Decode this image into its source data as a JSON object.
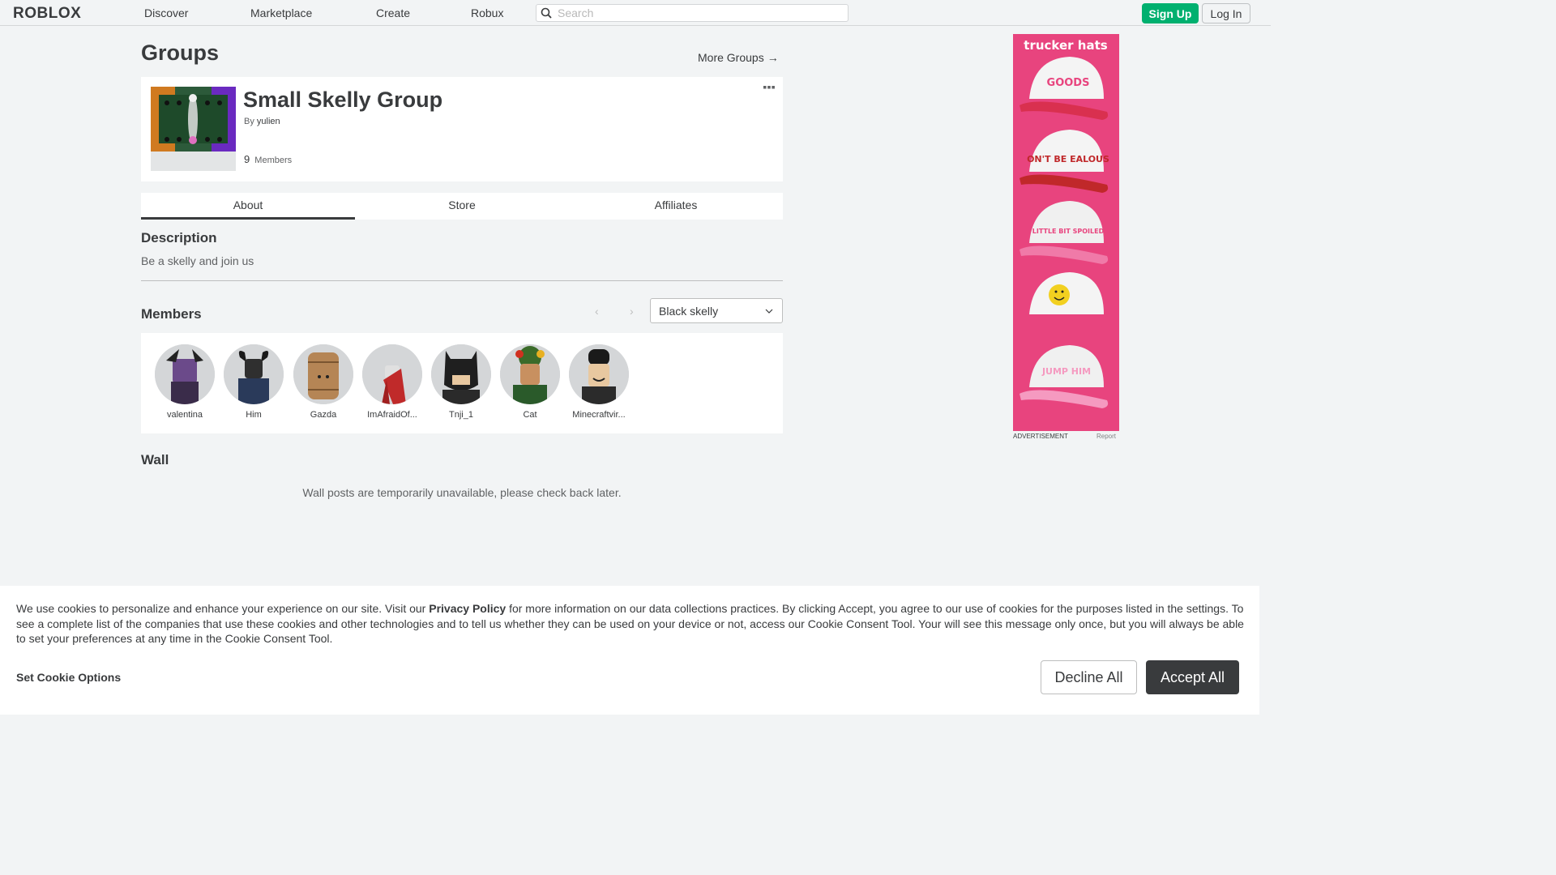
{
  "nav": {
    "logo": "ROBLOX",
    "links": [
      "Discover",
      "Marketplace",
      "Create",
      "Robux"
    ],
    "search_placeholder": "Search",
    "signup": "Sign Up",
    "login": "Log In"
  },
  "header": {
    "title": "Groups",
    "more_groups": "More Groups",
    "more_groups_arrow": "→"
  },
  "group": {
    "name": "Small Skelly Group",
    "owner_prefix": "By",
    "owner": "yulien",
    "member_count": "9",
    "members_label": "Members"
  },
  "tabs": [
    "About",
    "Store",
    "Affiliates"
  ],
  "description": {
    "title": "Description",
    "text": "Be a skelly and join us"
  },
  "members": {
    "title": "Members",
    "role_selected": "Black skelly",
    "prev": "‹",
    "next": "›",
    "list": [
      {
        "name": "valentina",
        "color": "#3a2c4a"
      },
      {
        "name": "Him",
        "color": "#2f2f2f"
      },
      {
        "name": "Gazda",
        "color": "#b58555"
      },
      {
        "name": "ImAfraidOf...",
        "color": "#c02a2a"
      },
      {
        "name": "Tnji_1",
        "color": "#1f1f1f"
      },
      {
        "name": "Cat",
        "color": "#3b6b2a"
      },
      {
        "name": "Minecraftvir...",
        "color": "#2b2b2b"
      }
    ]
  },
  "wall": {
    "title": "Wall",
    "message": "Wall posts are temporarily unavailable, please check back later."
  },
  "ad": {
    "heading": "trucker hats",
    "hat_texts": [
      "GOODS",
      "ON'T BE EALOUS",
      "LITTLE BIT SPOILED",
      "",
      "JUMP HIM"
    ],
    "label": "ADVERTISEMENT",
    "report": "Report"
  },
  "cookie": {
    "text_before": "We use cookies to personalize and enhance your experience on our site. Visit our ",
    "privacy_link": "Privacy Policy",
    "text_after": " for more information on our data collections practices. By clicking Accept, you agree to our use of cookies for the purposes listed in the settings. To see a complete list of the companies that use these cookies and other technologies and to tell us whether they can be used on your device or not, access our Cookie Consent Tool. Your will see this message only once, but you will always be able to set your preferences at any time in the Cookie Consent Tool.",
    "set_options": "Set Cookie Options",
    "decline": "Decline All",
    "accept": "Accept All"
  },
  "colors": {
    "accent_green": "#00b06f",
    "text_dark": "#393b3d",
    "background": "#f2f4f5",
    "ad_pink": "#e8447e"
  }
}
